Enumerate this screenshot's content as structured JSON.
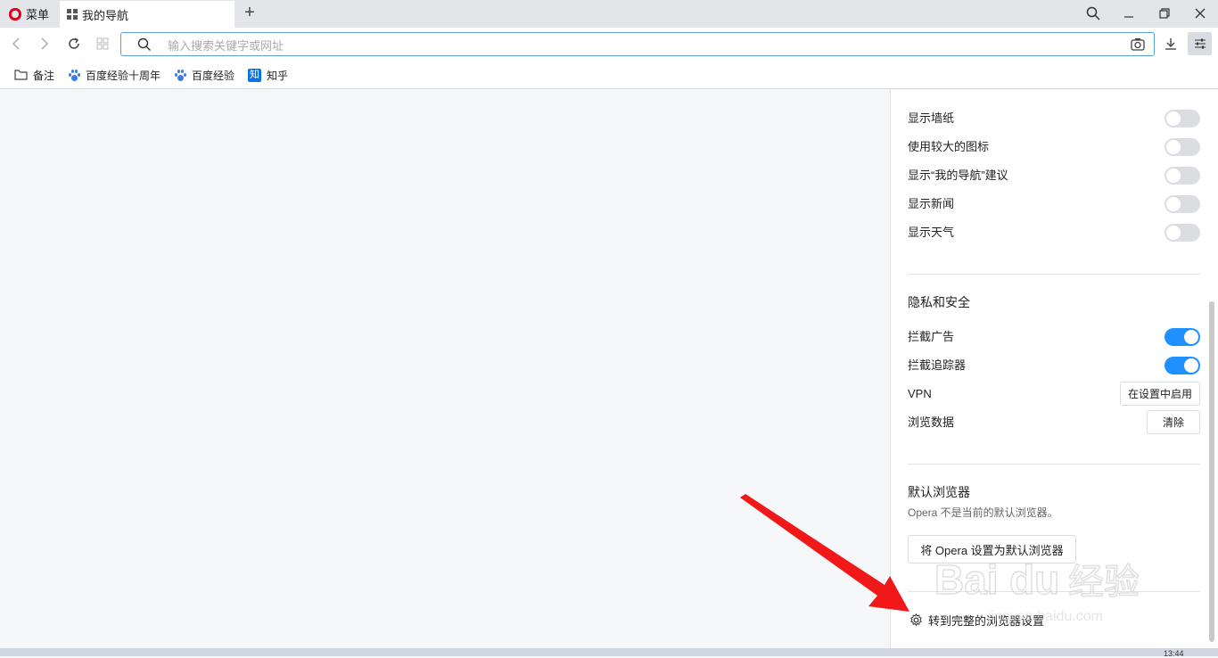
{
  "browser": {
    "menu_label": "菜单",
    "tab_title": "我的导航",
    "new_tab_symbol": "+",
    "address_placeholder": "输入搜索关键字或网址",
    "accent_color": "#1e90ff",
    "brand_color": "#e0001b"
  },
  "bookmarks": [
    {
      "label": "备注",
      "icon": "folder-icon"
    },
    {
      "label": "百度经验十周年",
      "icon": "baidu-paw-icon"
    },
    {
      "label": "百度经验",
      "icon": "baidu-paw-icon"
    },
    {
      "label": "知乎",
      "icon": "zhihu-icon",
      "icon_text": "知"
    }
  ],
  "settings_panel": {
    "display_toggles": [
      {
        "label": "显示墙纸",
        "on": false
      },
      {
        "label": "使用较大的图标",
        "on": false
      },
      {
        "label": "显示“我的导航”建议",
        "on": false
      },
      {
        "label": "显示新闻",
        "on": false
      },
      {
        "label": "显示天气",
        "on": false
      }
    ],
    "privacy": {
      "title": "隐私和安全",
      "block_ads": {
        "label": "拦截广告",
        "on": true
      },
      "block_trackers": {
        "label": "拦截追踪器",
        "on": true
      },
      "vpn": {
        "label": "VPN",
        "button": "在设置中启用"
      },
      "browsing_data": {
        "label": "浏览数据",
        "button": "清除"
      }
    },
    "default_browser": {
      "title": "默认浏览器",
      "description": "Opera 不是当前的默认浏览器。",
      "button": "将 Opera 设置为默认浏览器"
    },
    "full_settings_link": "转到完整的浏览器设置"
  },
  "taskbar": {
    "clock": "13:44"
  },
  "watermark": {
    "text": "Bai经验",
    "sub": "jingyan.baidu.com"
  }
}
